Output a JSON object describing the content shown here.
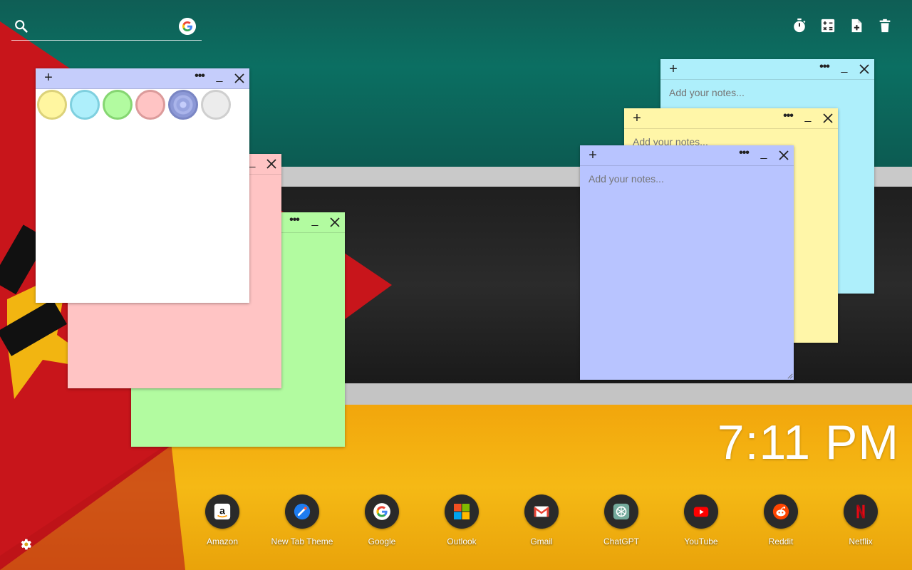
{
  "search": {
    "placeholder": "",
    "value": "",
    "search_icon": "search-icon",
    "engine_icon": "google-logo-icon"
  },
  "toolbar": {
    "icons": [
      "timer-icon",
      "calculator-icon",
      "add-note-icon",
      "trash-icon"
    ]
  },
  "colors": {
    "note_white": "#ffffff",
    "note_pink": "#ffc4c4",
    "note_green": "#b2fba0",
    "note_blue": "#b8c4ff",
    "note_yellow": "#fff6a8",
    "note_cyan": "#aeeffb",
    "clock_text": "#ffffff"
  },
  "color_picker": {
    "swatches": [
      {
        "name": "yellow",
        "fill": "#fff6a0",
        "ring": "#dcd27a"
      },
      {
        "name": "cyan",
        "fill": "#aeeffb",
        "ring": "#7fd0df"
      },
      {
        "name": "green",
        "fill": "#b2fba0",
        "ring": "#86d672"
      },
      {
        "name": "pink",
        "fill": "#ffc4c4",
        "ring": "#dc9b9b"
      },
      {
        "name": "blue",
        "fill": "#98a4e0",
        "ring": "#7a86c4",
        "selected": true
      },
      {
        "name": "gray",
        "fill": "#ececec",
        "ring": "#cfcfcf"
      }
    ]
  },
  "notes": {
    "placeholder": "Add your notes...",
    "cyan": {
      "text": ""
    },
    "yellow": {
      "text": ""
    },
    "blue": {
      "text": ""
    }
  },
  "clock": {
    "time": "7:11 PM"
  },
  "shortcuts": [
    {
      "label": "Amazon",
      "icon": "amazon-icon"
    },
    {
      "label": "New Tab Theme",
      "icon": "new-tab-theme-icon"
    },
    {
      "label": "Google",
      "icon": "google-icon"
    },
    {
      "label": "Outlook",
      "icon": "outlook-icon"
    },
    {
      "label": "Gmail",
      "icon": "gmail-icon"
    },
    {
      "label": "ChatGPT",
      "icon": "chatgpt-icon"
    },
    {
      "label": "YouTube",
      "icon": "youtube-icon"
    },
    {
      "label": "Reddit",
      "icon": "reddit-icon"
    },
    {
      "label": "Netflix",
      "icon": "netflix-icon"
    }
  ],
  "settings": {
    "icon": "gear-icon"
  }
}
